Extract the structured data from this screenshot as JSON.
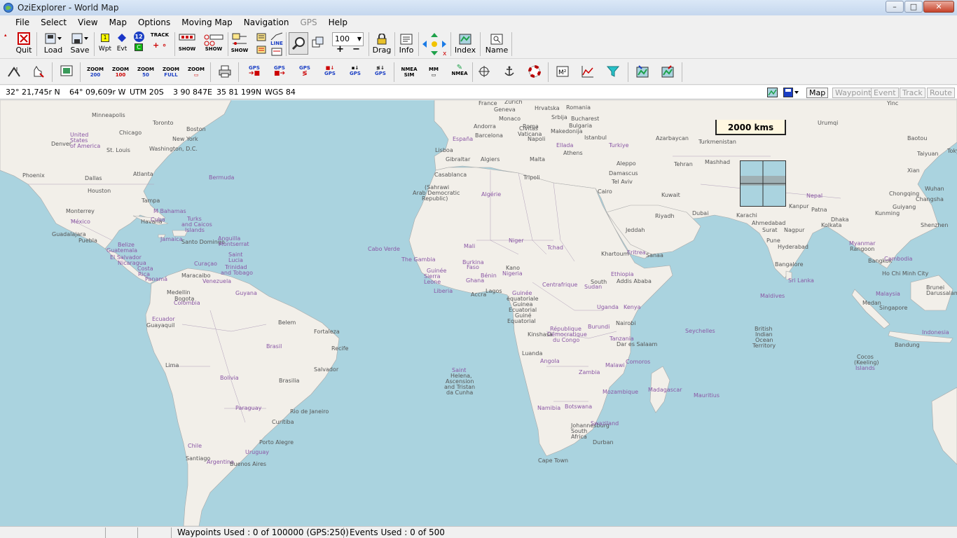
{
  "window": {
    "title": "OziExplorer - World Map",
    "minimize": "–",
    "maximize": "□",
    "close": "✕"
  },
  "menu": [
    "File",
    "Select",
    "View",
    "Map",
    "Options",
    "Moving Map",
    "Navigation",
    "GPS",
    "Help"
  ],
  "menu_disabled": [
    "GPS"
  ],
  "toolbar": {
    "quit": "Quit",
    "load": "Load",
    "save": "Save",
    "wpt": "Wpt",
    "evt": "Evt",
    "track": "TRACK",
    "show": "SHOW",
    "show2": "SHOW",
    "show3": "SHOW",
    "line": "LINE",
    "zoom_value": "100",
    "drag": "Drag",
    "info": "Info",
    "index": "Index",
    "name": "Name",
    "plus": "+",
    "minus": "−",
    "twelve": "12",
    "one": "1",
    "c_label": "C"
  },
  "toolbar2": {
    "zoom200": "ZOOM\n200",
    "zoom100": "ZOOM\n100",
    "zoom50": "ZOOM\n50",
    "zoomfull": "ZOOM\nFULL",
    "zoom": "ZOOM",
    "gps1": "GPS",
    "gps2": "GPS",
    "gps3": "GPS",
    "gps4": "GPS",
    "gps5": "GPS",
    "gps6": "GPS",
    "nmea_sim": "NMEA\nSIM",
    "mm": "MM",
    "nmea": "NMEA"
  },
  "coords": {
    "lat": "32° 21,745r N",
    "lon": "64° 09,609r W",
    "utm": "UTM  20S",
    "easting": "3 90 847E",
    "northing": "35 81 199N",
    "datum": "WGS 84"
  },
  "layer_tabs": [
    {
      "label": "Map",
      "enabled": true
    },
    {
      "label": "Waypoint",
      "enabled": false
    },
    {
      "label": "Event",
      "enabled": false
    },
    {
      "label": "Track",
      "enabled": false
    },
    {
      "label": "Route",
      "enabled": false
    }
  ],
  "map": {
    "scale": "2000 kms",
    "places": [
      [
        "Minneapolis",
        131,
        17
      ],
      [
        "Toronto",
        218,
        28
      ],
      [
        "Chicago",
        170,
        42
      ],
      [
        "Boston",
        266,
        37
      ],
      [
        "United",
        100,
        45
      ],
      [
        "States",
        100,
        53
      ],
      [
        "of America",
        100,
        61
      ],
      [
        "Denver",
        73,
        58
      ],
      [
        "New York",
        246,
        51
      ],
      [
        "St. Louis",
        152,
        67
      ],
      [
        "Washington, D.C.",
        213,
        65
      ],
      [
        "Phoenix",
        32,
        103
      ],
      [
        "Atlanta",
        190,
        101
      ],
      [
        "Bermuda",
        298,
        106
      ],
      [
        "Dallas",
        121,
        107
      ],
      [
        "Houston",
        125,
        125
      ],
      [
        "Tampa",
        202,
        139
      ],
      [
        "Monterrey",
        94,
        154
      ],
      [
        "M Bahamas",
        219,
        154
      ],
      [
        "México",
        101,
        169
      ],
      [
        "Havana",
        201,
        169
      ],
      [
        "Cuba",
        215,
        166
      ],
      [
        "Turks",
        267,
        165
      ],
      [
        "and Caicos",
        259,
        173
      ],
      [
        "Islands",
        264,
        181
      ],
      [
        "Guadalajara",
        74,
        187
      ],
      [
        "Puebla",
        112,
        196
      ],
      [
        "Jamaica",
        229,
        194
      ],
      [
        "Santo Domingo",
        259,
        198
      ],
      [
        "Anguilla",
        311,
        193
      ],
      [
        "Montserrat",
        312,
        201
      ],
      [
        "Belize",
        168,
        202
      ],
      [
        "Guatemala",
        152,
        210
      ],
      [
        "Saint",
        326,
        216
      ],
      [
        "Lucia",
        326,
        224
      ],
      [
        "El Salvador",
        157,
        220
      ],
      [
        "Nicaragua",
        168,
        228
      ],
      [
        "Curaçao",
        277,
        229
      ],
      [
        "Trinidad",
        321,
        234
      ],
      [
        "Costa",
        196,
        236
      ],
      [
        "and Tobago",
        315,
        242
      ],
      [
        "Rica",
        197,
        244
      ],
      [
        "Panamá",
        207,
        251
      ],
      [
        "Maracaibo",
        259,
        246
      ],
      [
        "Venezuela",
        289,
        254
      ],
      [
        "Medellin",
        238,
        270
      ],
      [
        "Guyana",
        336,
        271
      ],
      [
        "Bogota",
        249,
        279
      ],
      [
        "Colombia",
        248,
        285
      ],
      [
        "Ecuador",
        217,
        308
      ],
      [
        "Guayaquil",
        209,
        317
      ],
      [
        "Belem",
        397,
        313
      ],
      [
        "Fortaleza",
        448,
        326
      ],
      [
        "Brasil",
        380,
        347
      ],
      [
        "Recife",
        473,
        350
      ],
      [
        "Lima",
        236,
        374
      ],
      [
        "Salvador",
        448,
        380
      ],
      [
        "Bolivia",
        314,
        392
      ],
      [
        "Brasilia",
        398,
        396
      ],
      [
        "Paraguay",
        336,
        435
      ],
      [
        "Rio de Janeiro",
        414,
        440
      ],
      [
        "Curitiba",
        388,
        455
      ],
      [
        "Chile",
        268,
        489
      ],
      [
        "Porto Alegre",
        370,
        484
      ],
      [
        "Uruguay",
        350,
        498
      ],
      [
        "Santiago",
        265,
        507
      ],
      [
        "Argentina",
        295,
        512
      ],
      [
        "Buenos Aires",
        328,
        515
      ],
      [
        "France",
        683,
        0
      ],
      [
        "Zurich",
        720,
        -2
      ],
      [
        "Geneva",
        705,
        9
      ],
      [
        "Hrvatska",
        763,
        7
      ],
      [
        "Romania",
        808,
        6
      ],
      [
        "Srbija",
        787,
        20
      ],
      [
        "Bucharest",
        815,
        22
      ],
      [
        "Monaco",
        712,
        22
      ],
      [
        "Andorra",
        676,
        33
      ],
      [
        "Roma",
        746,
        33
      ],
      [
        "Bulgaria",
        812,
        32
      ],
      [
        "Civitas",
        741,
        36
      ],
      [
        "Vaticana",
        739,
        44
      ],
      [
        "Makedonija",
        786,
        40
      ],
      [
        "Barcelona",
        678,
        46
      ],
      [
        "España",
        646,
        51
      ],
      [
        "Napoli",
        753,
        51
      ],
      [
        "Ellada",
        794,
        60
      ],
      [
        "Istanbul",
        834,
        49
      ],
      [
        "Turkiye",
        869,
        60
      ],
      [
        "Lisboa",
        621,
        67
      ],
      [
        "Athens",
        804,
        71
      ],
      [
        "Gibraltar",
        636,
        80
      ],
      [
        "Algiers",
        686,
        80
      ],
      [
        "Malta",
        756,
        80
      ],
      [
        "Casablanca",
        620,
        102
      ],
      [
        "Tripoli",
        747,
        106
      ],
      [
        "(Sahrawi",
        606,
        120
      ],
      [
        "Arab Democratic",
        589,
        128
      ],
      [
        "Republic)",
        602,
        136
      ],
      [
        "Algérie",
        687,
        130
      ],
      [
        "Cairo",
        853,
        126
      ],
      [
        "Mali",
        662,
        204
      ],
      [
        "Niger",
        726,
        196
      ],
      [
        "Cabo Verde",
        525,
        208
      ],
      [
        "Tchad",
        781,
        206
      ],
      [
        "The Gambia",
        573,
        223
      ],
      [
        "Guinée",
        609,
        239
      ],
      [
        "Burkina",
        660,
        227
      ],
      [
        "Faso",
        666,
        234
      ],
      [
        "Kano",
        722,
        235
      ],
      [
        "Sierra",
        605,
        247
      ],
      [
        "Bénin",
        686,
        246
      ],
      [
        "Nigeria",
        717,
        243
      ],
      [
        "Leone",
        605,
        255
      ],
      [
        "Ghana",
        665,
        253
      ],
      [
        "Liberia",
        619,
        268
      ],
      [
        "Accra",
        672,
        273
      ],
      [
        "Lagos",
        693,
        268
      ],
      [
        "Centrafrique",
        774,
        259
      ],
      [
        "Guinée",
        731,
        271
      ],
      [
        "équatoriale",
        723,
        279
      ],
      [
        "Guinea",
        732,
        287
      ],
      [
        "Ecuatorial",
        726,
        295
      ],
      [
        "Guiné",
        735,
        303
      ],
      [
        "Equatorial",
        724,
        311
      ],
      [
        "République",
        785,
        322
      ],
      [
        "Démocratique",
        781,
        330
      ],
      [
        "du Congo",
        789,
        338
      ],
      [
        "Kinshasa",
        753,
        330
      ],
      [
        "Luanda",
        745,
        357
      ],
      [
        "Angola",
        771,
        368
      ],
      [
        "Zambia",
        826,
        384
      ],
      [
        "Namibia",
        767,
        435
      ],
      [
        "Botswana",
        806,
        433
      ],
      [
        "Johannesburg",
        815,
        460
      ],
      [
        "South",
        815,
        468
      ],
      [
        "Africa",
        815,
        476
      ],
      [
        "Swaziland",
        843,
        457
      ],
      [
        "Durban",
        846,
        484
      ],
      [
        "Cape Town",
        768,
        510
      ],
      [
        "Saint",
        645,
        381
      ],
      [
        "Helena,",
        643,
        389
      ],
      [
        "Ascension",
        636,
        397
      ],
      [
        "and Tristan",
        634,
        405
      ],
      [
        "da Cunha",
        637,
        413
      ],
      [
        "Sudan",
        834,
        262
      ],
      [
        "South",
        843,
        255
      ],
      [
        "Uganda",
        852,
        291
      ],
      [
        "Kenya",
        890,
        291
      ],
      [
        "Nairobi",
        879,
        314
      ],
      [
        "Burundi",
        839,
        319
      ],
      [
        "Tanzania",
        870,
        336
      ],
      [
        "Dar es Salaam",
        880,
        344
      ],
      [
        "Malawi",
        864,
        374
      ],
      [
        "Mozambique",
        860,
        412
      ],
      [
        "Comoros",
        893,
        369
      ],
      [
        "Madagascar",
        925,
        409
      ],
      [
        "Mauritius",
        990,
        417
      ],
      [
        "Seychelles",
        978,
        325
      ],
      [
        "Ethiopia",
        872,
        244
      ],
      [
        "Addis Ababa",
        880,
        254
      ],
      [
        "Eritrea",
        895,
        213
      ],
      [
        "Khartoum",
        858,
        215
      ],
      [
        "Jeddah",
        893,
        181
      ],
      [
        "Riyadh",
        935,
        161
      ],
      [
        "Sanaa",
        922,
        217
      ],
      [
        "Dubai",
        988,
        157
      ],
      [
        "Kuwait",
        944,
        131
      ],
      [
        "Tehran",
        962,
        87
      ],
      [
        "Mashhad",
        1006,
        84
      ],
      [
        "Damascus",
        869,
        100
      ],
      [
        "Tel Aviv",
        873,
        112
      ],
      [
        "Aleppo",
        880,
        86
      ],
      [
        "Azarbaycan",
        936,
        50
      ],
      [
        "Turkmenistan",
        997,
        55
      ],
      [
        "Karachi",
        1051,
        160
      ],
      [
        "Ahmedabad",
        1073,
        171
      ],
      [
        "Surat",
        1088,
        181
      ],
      [
        "Nagpur",
        1119,
        181
      ],
      [
        "Kanpur",
        1126,
        147
      ],
      [
        "Patna",
        1158,
        152
      ],
      [
        "Dhaka",
        1186,
        166
      ],
      [
        "Kolkata",
        1172,
        174
      ],
      [
        "Nepal",
        1151,
        132
      ],
      [
        "Pune",
        1094,
        196
      ],
      [
        "Hyderabad",
        1110,
        205
      ],
      [
        "Bangalore",
        1106,
        230
      ],
      [
        "Sri Lanka",
        1125,
        253
      ],
      [
        "Maldives",
        1085,
        275
      ],
      [
        "British",
        1077,
        322
      ],
      [
        "Indian",
        1078,
        330
      ],
      [
        "Ocean",
        1078,
        338
      ],
      [
        "Territory",
        1074,
        346
      ],
      [
        "Urumqi",
        1167,
        28
      ],
      [
        "Baotou",
        1295,
        50
      ],
      [
        "Taiyuan",
        1309,
        72
      ],
      [
        "Xian",
        1295,
        96
      ],
      [
        "Wuhan",
        1320,
        122
      ],
      [
        "Chongqing",
        1269,
        129
      ],
      [
        "Guiyang",
        1274,
        148
      ],
      [
        "Changsha",
        1307,
        137
      ],
      [
        "Kunming",
        1249,
        157
      ],
      [
        "Shenzhen",
        1314,
        174
      ],
      [
        "Myanmar",
        1212,
        200
      ],
      [
        "Rangoon",
        1213,
        208
      ],
      [
        "Bangkok",
        1239,
        225
      ],
      [
        "Cambodia",
        1262,
        222
      ],
      [
        "Ho Chi Minh City",
        1259,
        243
      ],
      [
        "Malaysia",
        1250,
        272
      ],
      [
        "Brunei",
        1322,
        263
      ],
      [
        "Darussalam",
        1322,
        271
      ],
      [
        "Medan",
        1231,
        285
      ],
      [
        "Singapore",
        1255,
        292
      ],
      [
        "Indonesia",
        1316,
        327
      ],
      [
        "Bandung",
        1277,
        345
      ],
      [
        "Cocos",
        1223,
        362
      ],
      [
        "(Keeling)",
        1219,
        370
      ],
      [
        "Islands",
        1221,
        378
      ],
      [
        "Yinc",
        1266,
        0
      ],
      [
        "Tokyo",
        1352,
        68
      ]
    ],
    "countries": [
      "United",
      "States",
      "of America",
      "Brasil",
      "Bolivia",
      "Venezuela",
      "Colombia",
      "Ecuador",
      "Paraguay",
      "Uruguay",
      "Argentina",
      "Chile",
      "México",
      "Cuba",
      "Guyana",
      "Mali",
      "Niger",
      "Tchad",
      "Nigeria",
      "Angola",
      "Zambia",
      "Namibia",
      "Botswana",
      "Madagascar",
      "Kenya",
      "Uganda",
      "Tanzania",
      "Ethiopia",
      "Sudan",
      "Sierra",
      "Leone",
      "Liberia",
      "Ghana",
      "Bénin",
      "Algérie",
      "España",
      "Ellada",
      "Turkiye",
      "Malawi",
      "Mozambique",
      "Burundi",
      "Nepal",
      "Malaysia",
      "Indonesia",
      "Myanmar",
      "Cambodia",
      "Sri Lanka",
      "Maldives",
      "Seychelles",
      "Mauritius",
      "Comoros",
      "Eritrea",
      "Swaziland",
      "Centrafrique",
      "Guinée",
      "The Gambia",
      "Cabo Verde",
      "Jamaica",
      "Belize",
      "Guatemala",
      "El Salvador",
      "Nicaragua",
      "Costa",
      "Rica",
      "Panamá",
      "Bermuda",
      "Anguilla",
      "Montserrat",
      "Saint",
      "Lucia",
      "Trinidad",
      "and Tobago",
      "Turks",
      "and Caicos",
      "Islands",
      "M Bahamas",
      "Curaçao",
      "Burkina",
      "Faso",
      "République",
      "Démocratique",
      "du Congo"
    ]
  },
  "status": {
    "waypoints": "Waypoints Used : 0 of 100000  (GPS:250)",
    "events": "Events Used : 0 of 500"
  },
  "colors": {
    "sea": "#aad3df",
    "land": "#f2efe9",
    "border": "#a0a0a0",
    "country_label": "#8a57a5"
  }
}
